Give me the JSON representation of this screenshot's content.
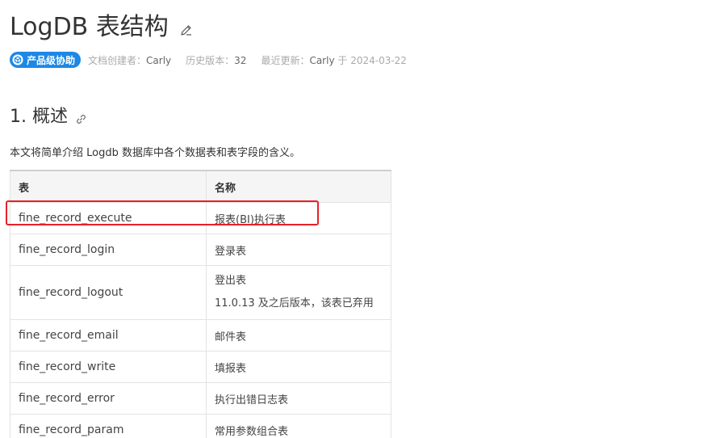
{
  "doc": {
    "title": "LogDB 表结构",
    "badge": "产品级协助",
    "meta": {
      "creator_label": "文档创建者：",
      "creator": "Carly",
      "history_label": "历史版本：",
      "history": "32",
      "updated_label": "最近更新：",
      "updated_by": "Carly",
      "updated_at": "于 2024-03-22"
    }
  },
  "section": {
    "title": "1. 概述",
    "intro": "本文将简单介绍 Logdb 数据库中各个数据表和表字段的含义。"
  },
  "table": {
    "headers": [
      "表",
      "名称"
    ],
    "rows": [
      {
        "table": "fine_record_execute",
        "name": "报表(BI)执行表"
      },
      {
        "table": "fine_record_login",
        "name": "登录表"
      },
      {
        "table": "fine_record_logout",
        "name": "登出表",
        "note": "11.0.13 及之后版本，该表已弃用"
      },
      {
        "table": "fine_record_email",
        "name": "邮件表"
      },
      {
        "table": "fine_record_write",
        "name": "填报表"
      },
      {
        "table": "fine_record_error",
        "name": "执行出错日志表"
      },
      {
        "table": "fine_record_param",
        "name": "常用参数组合表"
      }
    ]
  },
  "colors": {
    "badge": "#1e88e5",
    "highlight": "#e8202a"
  },
  "icons": {
    "edit": "pencil-icon",
    "link": "link-icon",
    "badge": "cube-icon"
  }
}
